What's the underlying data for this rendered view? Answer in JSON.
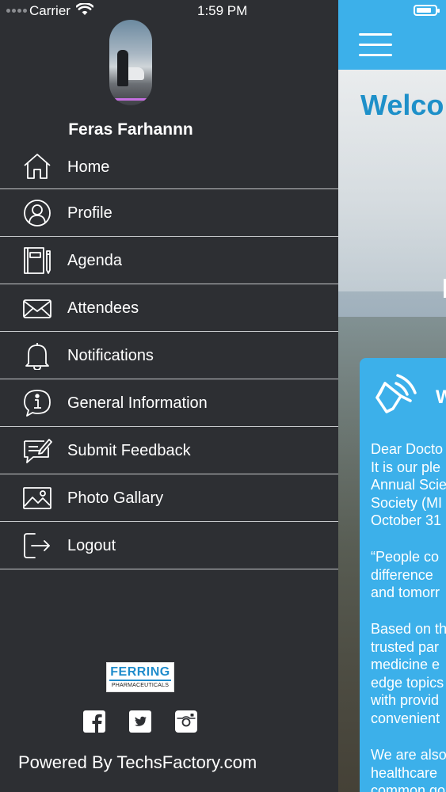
{
  "status_bar": {
    "carrier": "Carrier",
    "time": "1:59 PM"
  },
  "profile": {
    "name": "Feras Farhannn"
  },
  "menu": [
    {
      "label": "Home",
      "icon": "home-icon"
    },
    {
      "label": "Profile",
      "icon": "profile-icon"
    },
    {
      "label": "Agenda",
      "icon": "agenda-icon"
    },
    {
      "label": "Attendees",
      "icon": "envelope-icon"
    },
    {
      "label": "Notifications",
      "icon": "bell-icon"
    },
    {
      "label": "General Information",
      "icon": "info-icon"
    },
    {
      "label": "Submit Feedback",
      "icon": "feedback-icon"
    },
    {
      "label": "Photo Gallary",
      "icon": "photo-icon"
    },
    {
      "label": "Logout",
      "icon": "logout-icon"
    }
  ],
  "sponsor": {
    "brand": "FERRING",
    "subtitle": "PHARMACEUTICALS"
  },
  "social": [
    "facebook-icon",
    "twitter-icon",
    "instagram-icon"
  ],
  "footer": {
    "powered_by": "Powered By TechsFactory.com"
  },
  "content": {
    "title": "Welco",
    "card_heading": "W",
    "paragraph_1": "Dear Docto\nIt is our ple\nAnnual Scie\nSociety (MI\nOctober 31",
    "paragraph_2": "“People co\ndifference \nand tomorr",
    "paragraph_3": "Based on th\ntrusted par\nmedicine e\nedge topics\nwith provid\nconvenient",
    "paragraph_4": "We are also\nhealthcare \ncommon go"
  },
  "colors": {
    "drawer_bg": "#2d2f33",
    "accent_blue": "#3cb0ea",
    "title_blue": "#1e90c9",
    "divider": "#c7c9cc"
  }
}
